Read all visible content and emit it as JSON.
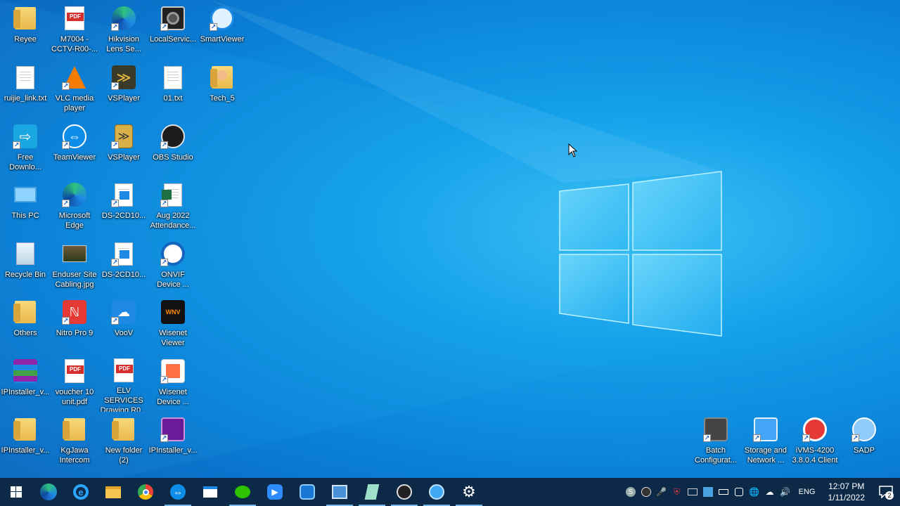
{
  "desktop": {
    "icons": [
      {
        "label": "Reyee",
        "icon": "folder-icon"
      },
      {
        "label": "M7004 -\nCCTV-R00-...",
        "icon": "pdf-icon"
      },
      {
        "label": "Hikvision\nLens Se...",
        "icon": "edge-icon"
      },
      {
        "label": "LocalServic...",
        "icon": "camera-icon"
      },
      {
        "label": "SmartViewer",
        "icon": "smartviewer-icon"
      },
      {
        "label": "ruijie_link.txt",
        "icon": "text-file-icon"
      },
      {
        "label": "VLC media\nplayer",
        "icon": "vlc-icon"
      },
      {
        "label": "VSPlayer",
        "icon": "vsplayer-icon"
      },
      {
        "label": "01.txt",
        "icon": "text-file-icon"
      },
      {
        "label": "Tech_5",
        "icon": "user-folder-icon"
      },
      {
        "label": "Free\nDownlo...",
        "icon": "download-icon"
      },
      {
        "label": "TeamViewer",
        "icon": "teamviewer-icon"
      },
      {
        "label": "VSPlayer",
        "icon": "archive-icon"
      },
      {
        "label": "OBS Studio",
        "icon": "obs-icon"
      },
      {
        "label": "This PC",
        "icon": "computer-icon"
      },
      {
        "label": "Microsoft\nEdge",
        "icon": "edge-icon"
      },
      {
        "label": "DS-2CD10...",
        "icon": "document-icon"
      },
      {
        "label": "Aug 2022\nAttendance...",
        "icon": "excel-icon"
      },
      {
        "label": "Recycle Bin",
        "icon": "recycle-bin-icon"
      },
      {
        "label": "Enduser Site\nCabling.jpg",
        "icon": "image-icon"
      },
      {
        "label": "DS-2CD10...",
        "icon": "document-icon"
      },
      {
        "label": "ONVIF\nDevice ...",
        "icon": "onvif-icon"
      },
      {
        "label": "Others",
        "icon": "folder-icon"
      },
      {
        "label": "Nitro Pro 9",
        "icon": "nitro-icon"
      },
      {
        "label": "VooV",
        "icon": "voov-icon"
      },
      {
        "label": "Wisenet\nViewer",
        "icon": "wisenet-viewer-icon"
      },
      {
        "label": "IPInstaller_v...",
        "icon": "winrar-icon"
      },
      {
        "label": "voucher 10\nunit.pdf",
        "icon": "pdf-icon"
      },
      {
        "label": "ELV SERVICES\nDrawing R0...",
        "icon": "pdf-icon"
      },
      {
        "label": "Wisenet\nDevice ...",
        "icon": "wisenet-device-icon"
      },
      {
        "label": "IPInstaller_v...",
        "icon": "folder-icon"
      },
      {
        "label": "KgJawa\nIntercom",
        "icon": "folder-icon"
      },
      {
        "label": "New folder\n(2)",
        "icon": "folder-icon"
      },
      {
        "label": "IPInstaller_v...",
        "icon": "ipinstaller-icon"
      },
      {
        "label": "Batch\nConfigurat...",
        "icon": "batch-config-icon"
      },
      {
        "label": "Storage and\nNetwork ...",
        "icon": "storage-icon"
      },
      {
        "label": "iVMS-4200\n3.8.0.4 Client",
        "icon": "ivms-icon"
      },
      {
        "label": "SADP",
        "icon": "sadp-icon"
      }
    ]
  },
  "pdf_badge": "PDF",
  "wnv_badge": "WNV",
  "taskbar": {
    "apps": [
      "start-icon",
      "edge-icon",
      "ie-icon",
      "file-explorer-icon",
      "chrome-icon",
      "teamviewer-icon",
      "window-icon",
      "wechat-icon",
      "zoom-icon",
      "remote-icon",
      "excel-icon",
      "notepad-icon",
      "obs-icon",
      "search-app-icon",
      "settings-icon"
    ],
    "language": "ENG",
    "time": "12:07 PM",
    "date": "1/11/2022",
    "notification_count": "2"
  },
  "colors": {
    "desktop_blue": "#0a7fd6",
    "taskbar": "#0c2a48",
    "accent": "#76b9ed"
  }
}
